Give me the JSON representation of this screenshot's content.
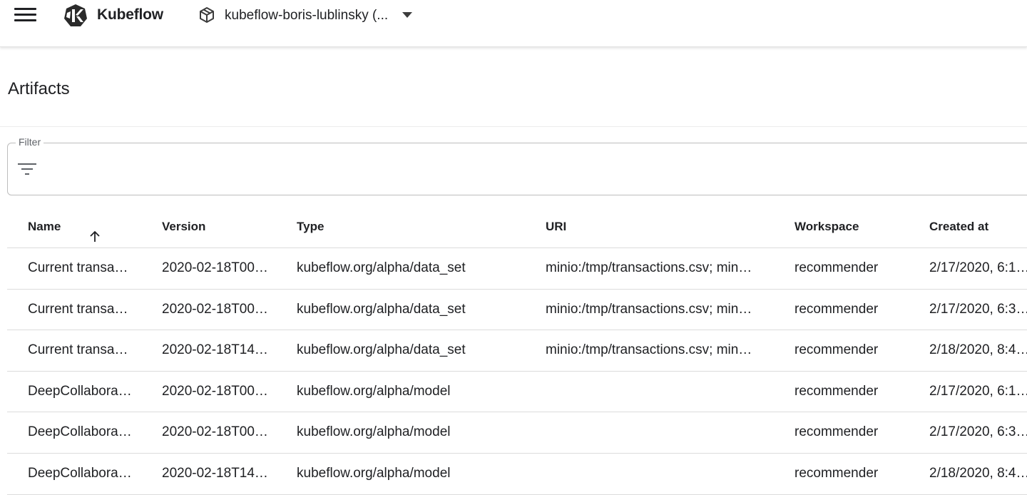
{
  "app": {
    "brand": "Kubeflow",
    "namespace_label": "kubeflow-boris-lublinsky (...",
    "icons": {
      "menu": "hamburger-menu-icon",
      "logo": "kubeflow-logo",
      "namespace": "cube-icon",
      "namespace_dropdown": "caret-down-icon",
      "filter": "filter-list-icon",
      "sort": "arrow-up-icon"
    }
  },
  "page": {
    "title": "Artifacts"
  },
  "filter": {
    "label": "Filter",
    "value": ""
  },
  "table": {
    "headers": {
      "name": "Name",
      "version": "Version",
      "type": "Type",
      "uri": "URI",
      "workspace": "Workspace",
      "created": "Created at"
    },
    "sorted_by": "Name",
    "sort_direction": "ascending",
    "rows": [
      {
        "name": "Current transa…",
        "version": "2020-02-18T00…",
        "type": "kubeflow.org/alpha/data_set",
        "uri": "minio:/tmp/transactions.csv; min…",
        "workspace": "recommender",
        "created": "2/17/2020, 6:1…"
      },
      {
        "name": "Current transa…",
        "version": "2020-02-18T00…",
        "type": "kubeflow.org/alpha/data_set",
        "uri": "minio:/tmp/transactions.csv; min…",
        "workspace": "recommender",
        "created": "2/17/2020, 6:3…"
      },
      {
        "name": "Current transa…",
        "version": "2020-02-18T14…",
        "type": "kubeflow.org/alpha/data_set",
        "uri": "minio:/tmp/transactions.csv; min…",
        "workspace": "recommender",
        "created": "2/18/2020, 8:4…"
      },
      {
        "name": "DeepCollabora…",
        "version": "2020-02-18T00…",
        "type": "kubeflow.org/alpha/model",
        "uri": "",
        "workspace": "recommender",
        "created": "2/17/2020, 6:1…"
      },
      {
        "name": "DeepCollabora…",
        "version": "2020-02-18T00…",
        "type": "kubeflow.org/alpha/model",
        "uri": "",
        "workspace": "recommender",
        "created": "2/17/2020, 6:3…"
      },
      {
        "name": "DeepCollabora…",
        "version": "2020-02-18T14…",
        "type": "kubeflow.org/alpha/model",
        "uri": "",
        "workspace": "recommender",
        "created": "2/18/2020, 8:4…"
      }
    ]
  }
}
